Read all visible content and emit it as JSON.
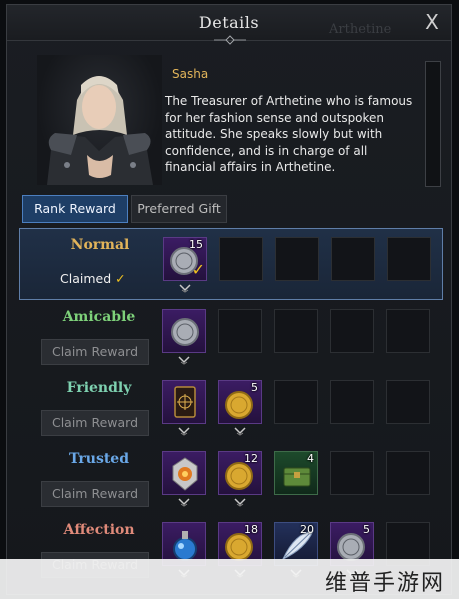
{
  "window": {
    "title": "Details",
    "ghost_text": "Arthetine",
    "close_label": "X"
  },
  "npc": {
    "name": "Sasha",
    "description": "The Treasurer of Arthetine who is famous for her fashion sense and outspoken attitude. She speaks slowly but with confidence, and is in charge of all financial affairs in Arthetine."
  },
  "tabs": [
    {
      "label": "Rank Reward",
      "active": true
    },
    {
      "label": "Preferred Gift",
      "active": false
    }
  ],
  "tiers": [
    {
      "name": "Normal",
      "color": "#e2b45a",
      "status": "Claimed",
      "claimed": true,
      "rewards": [
        {
          "icon": "silver-coin-icon",
          "qty": "15",
          "claimed": true
        }
      ]
    },
    {
      "name": "Amicable",
      "color": "#7ed17a",
      "button": "Claim Reward",
      "rewards": [
        {
          "icon": "silver-coin-icon",
          "qty": ""
        }
      ]
    },
    {
      "name": "Friendly",
      "color": "#7ed1b0",
      "button": "Claim Reward",
      "rewards": [
        {
          "icon": "card-icon",
          "qty": ""
        },
        {
          "icon": "gold-coin-icon",
          "qty": "5"
        }
      ]
    },
    {
      "name": "Trusted",
      "color": "#6aa8e8",
      "button": "Claim Reward",
      "rewards": [
        {
          "icon": "emblem-icon",
          "qty": ""
        },
        {
          "icon": "gold-coin-icon",
          "qty": "12"
        },
        {
          "icon": "chest-icon",
          "qty": "4"
        }
      ]
    },
    {
      "name": "Affection",
      "color": "#e08a7a",
      "button": "Claim Reward",
      "rewards": [
        {
          "icon": "potion-icon",
          "qty": ""
        },
        {
          "icon": "gold-coin-icon",
          "qty": "18"
        },
        {
          "icon": "feather-icon",
          "qty": "20"
        },
        {
          "icon": "silver-coin-icon",
          "qty": "5"
        }
      ]
    }
  ],
  "watermark": {
    "text": "维普手游网"
  },
  "colors": {
    "accent": "#4c7fbf",
    "gold": "#e2b45a",
    "reward_bg": "#3b1c63"
  }
}
